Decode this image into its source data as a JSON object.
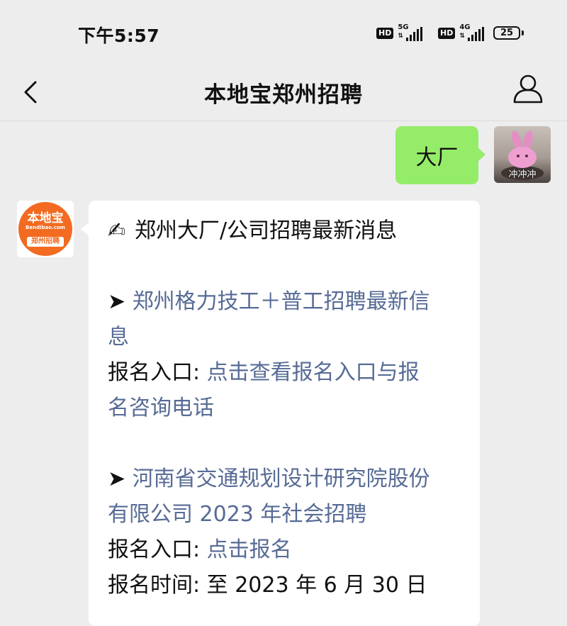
{
  "status_bar": {
    "time": "下午5:57",
    "sim1": {
      "hd": "HD",
      "network": "5G"
    },
    "sim2": {
      "hd": "HD",
      "network": "4G"
    },
    "battery": "25"
  },
  "nav": {
    "title": "本地宝郑州招聘",
    "back_icon": "chevron-left-icon",
    "profile_icon": "person-icon"
  },
  "outgoing": {
    "text": "大厂",
    "avatar_caption": "冲冲冲"
  },
  "account_avatar": {
    "top": "本地宝",
    "url": "Bendibao.com",
    "bottom": "郑州招聘"
  },
  "incoming": {
    "headline_icon": "✍",
    "headline": "郑州大厂/公司招聘最新消息",
    "item1": {
      "marker": "➤",
      "title_line1": "郑州格力技工＋普工招聘最新信",
      "title_line2": "息",
      "signup_label": "报名入口:",
      "signup_link_line1": "点击查看报名入口与报",
      "signup_link_line2": "名咨询电话"
    },
    "item2": {
      "marker": "➤",
      "title_line1": "河南省交通规划设计研究院股份",
      "title_line2": "有限公司 2023 年社会招聘",
      "signup_label": "报名入口:",
      "signup_link": "点击报名",
      "time_label": "报名时间:",
      "time_value": "至 2023 年 6 月 30 日"
    }
  },
  "colors": {
    "page_bg": "#ededed",
    "outgoing_bubble": "#95ec69",
    "incoming_bubble": "#ffffff",
    "link": "#576b95",
    "brand_orange": "#f26b21"
  }
}
